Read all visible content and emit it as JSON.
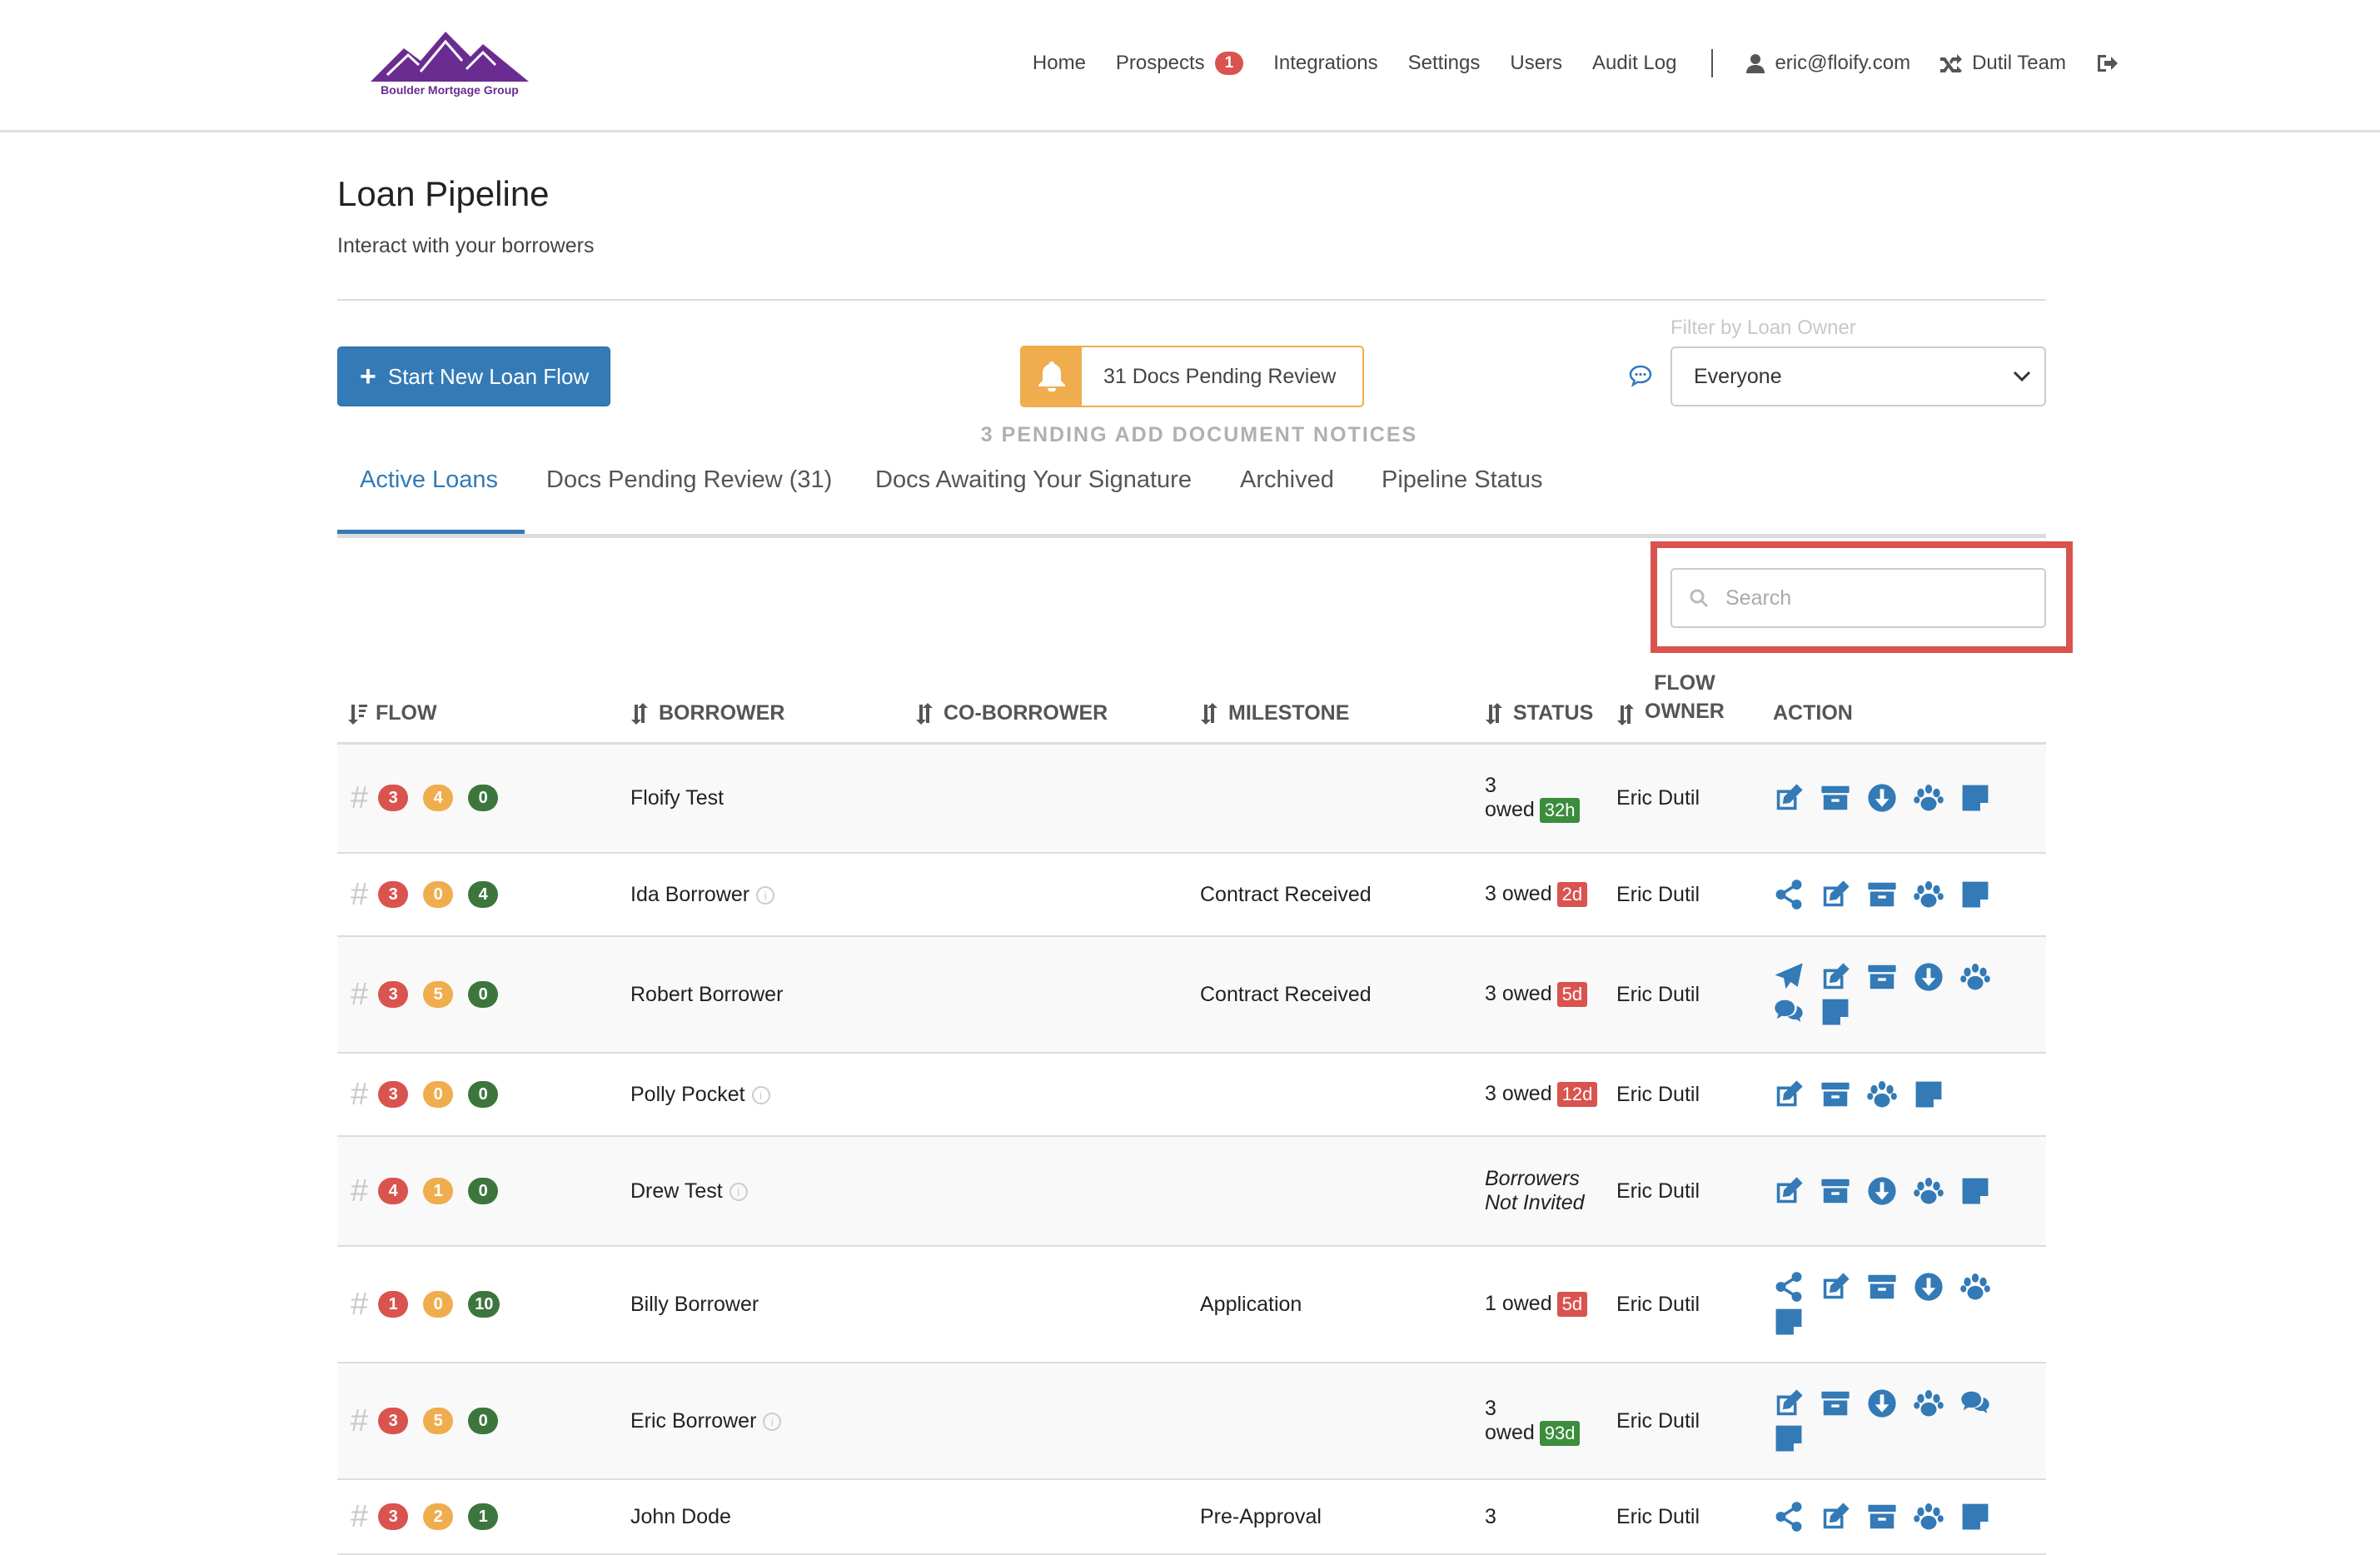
{
  "brand": {
    "name": "Boulder Mortgage Group",
    "color": "#6b2c91"
  },
  "nav": {
    "home": "Home",
    "prospects": "Prospects",
    "prospects_count": "1",
    "integrations": "Integrations",
    "settings": "Settings",
    "users": "Users",
    "audit_log": "Audit Log",
    "user_email": "eric@floify.com",
    "team": "Dutil Team"
  },
  "page": {
    "title": "Loan Pipeline",
    "subtitle": "Interact with your borrowers"
  },
  "toolbar": {
    "start_button": "Start New Loan Flow",
    "pending_review": "31 Docs Pending Review",
    "notices": "3 PENDING ADD DOCUMENT NOTICES",
    "filter_label": "Filter by Loan Owner",
    "filter_value": "Everyone"
  },
  "tabs": [
    {
      "label": "Active Loans"
    },
    {
      "label": "Docs Pending Review (31)"
    },
    {
      "label": "Docs Awaiting Your Signature"
    },
    {
      "label": "Archived"
    },
    {
      "label": "Pipeline Status"
    }
  ],
  "search": {
    "placeholder": "Search"
  },
  "table": {
    "headers": {
      "flow": "FLOW",
      "borrower": "BORROWER",
      "co_borrower": "CO-BORROWER",
      "milestone": "MILESTONE",
      "status": "STATUS",
      "flow_owner_1": "FLOW",
      "flow_owner_2": "OWNER",
      "action": "ACTION"
    },
    "rows": [
      {
        "counts": [
          "3",
          "4",
          "0"
        ],
        "borrower": "Floify Test",
        "info": false,
        "milestone": "",
        "status_a": "3",
        "status_b": "owed",
        "age": "32h",
        "age_color": "green",
        "owner": "Eric Dutil",
        "icons": [
          "edit-icon",
          "archive-icon",
          "download-icon",
          "paw-icon",
          "note-icon"
        ]
      },
      {
        "counts": [
          "3",
          "0",
          "4"
        ],
        "borrower": "Ida Borrower",
        "info": true,
        "milestone": "Contract Received",
        "status_a": "3 owed",
        "status_b": "",
        "age": "2d",
        "age_color": "red",
        "owner": "Eric Dutil",
        "icons": [
          "share-icon",
          "edit-icon",
          "archive-icon",
          "paw-icon",
          "note-icon"
        ]
      },
      {
        "counts": [
          "3",
          "5",
          "0"
        ],
        "borrower": "Robert Borrower",
        "info": false,
        "milestone": "Contract Received",
        "status_a": "3 owed",
        "status_b": "",
        "age": "5d",
        "age_color": "red",
        "owner": "Eric Dutil",
        "icons": [
          "send-icon",
          "edit-icon",
          "archive-icon",
          "download-icon",
          "paw-icon",
          "comments-icon",
          "note-icon"
        ]
      },
      {
        "counts": [
          "3",
          "0",
          "0"
        ],
        "borrower": "Polly Pocket",
        "info": true,
        "milestone": "",
        "status_a": "3 owed",
        "status_b": "",
        "age": "12d",
        "age_color": "red",
        "owner": "Eric Dutil",
        "icons": [
          "edit-icon",
          "archive-icon",
          "paw-icon",
          "note-icon"
        ]
      },
      {
        "counts": [
          "4",
          "1",
          "0"
        ],
        "borrower": "Drew Test",
        "info": true,
        "milestone": "",
        "status_a": "Borrowers",
        "status_b": "Not Invited",
        "italic": true,
        "age": "",
        "age_color": "",
        "owner": "Eric Dutil",
        "icons": [
          "edit-icon",
          "archive-icon",
          "download-icon",
          "paw-icon",
          "note-icon"
        ]
      },
      {
        "counts": [
          "1",
          "0",
          "10"
        ],
        "borrower": "Billy Borrower",
        "info": false,
        "milestone": "Application",
        "status_a": "1 owed",
        "status_b": "",
        "age": "5d",
        "age_color": "red",
        "owner": "Eric Dutil",
        "icons": [
          "share-icon",
          "edit-icon",
          "archive-icon",
          "download-icon",
          "paw-icon",
          "note-icon"
        ]
      },
      {
        "counts": [
          "3",
          "5",
          "0"
        ],
        "borrower": "Eric Borrower",
        "info": true,
        "milestone": "",
        "status_a": "3",
        "status_b": "owed",
        "age": "93d",
        "age_color": "green",
        "owner": "Eric Dutil",
        "icons": [
          "edit-icon",
          "archive-icon",
          "download-icon",
          "paw-icon",
          "comments-icon",
          "note-icon"
        ]
      },
      {
        "counts": [
          "3",
          "2",
          "1"
        ],
        "borrower": "John Dode",
        "info": false,
        "milestone": "Pre-Approval",
        "status_a": "3",
        "status_b": "",
        "age": "",
        "age_color": "",
        "owner": "Eric Dutil",
        "icons": [
          "share-icon",
          "edit-icon",
          "archive-icon",
          "paw-icon",
          "note-icon"
        ]
      }
    ]
  }
}
